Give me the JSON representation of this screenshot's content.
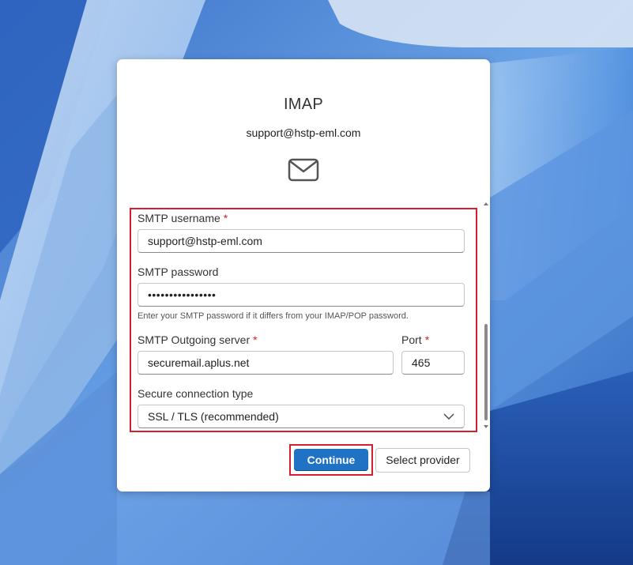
{
  "dialog": {
    "title": "IMAP",
    "account_email": "support@hstp-eml.com",
    "icon": "envelope-icon"
  },
  "form": {
    "smtp_username": {
      "label": "SMTP username",
      "required_marker": "*",
      "value": "support@hstp-eml.com"
    },
    "smtp_password": {
      "label": "SMTP password",
      "value": "••••••••••••••••",
      "hint": "Enter your SMTP password if it differs from your IMAP/POP password."
    },
    "smtp_server": {
      "label": "SMTP Outgoing server",
      "required_marker": "*",
      "value": "securemail.aplus.net"
    },
    "port": {
      "label": "Port",
      "required_marker": "*",
      "value": "465"
    },
    "secure_connection": {
      "label": "Secure connection type",
      "value": "SSL / TLS (recommended)"
    }
  },
  "buttons": {
    "continue": "Continue",
    "select_provider": "Select provider"
  },
  "colors": {
    "accent": "#1f72c4",
    "highlight_border": "#d32030",
    "required": "#d32030"
  }
}
